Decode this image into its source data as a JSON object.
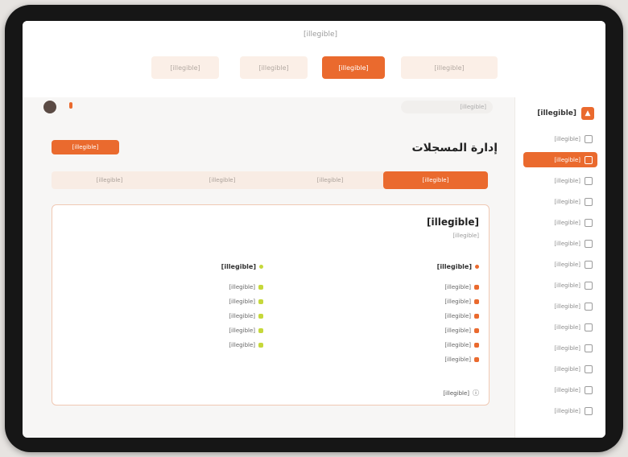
{
  "colors": {
    "accent": "#ea6a2e",
    "accent_soft": "#f8ece4",
    "green": "#c6d83b",
    "frame": "#161616"
  },
  "banner": {
    "text": "[illegible]",
    "tabs": [
      {
        "label": "[illegible]",
        "active": false
      },
      {
        "label": "[illegible]",
        "active": true
      },
      {
        "label": "[illegible]",
        "active": false
      },
      {
        "label": "[illegible]",
        "active": false
      }
    ]
  },
  "topbar": {
    "search_placeholder": "[illegible]"
  },
  "sidebar": {
    "logo_text": "[illegible]",
    "items": [
      {
        "label": "[illegible]",
        "icon": "home-icon",
        "active": false
      },
      {
        "label": "[illegible]",
        "icon": "list-icon",
        "active": true
      },
      {
        "label": "[illegible]",
        "icon": "gear-icon",
        "active": false
      },
      {
        "label": "[illegible]",
        "icon": "user-icon",
        "active": false
      },
      {
        "label": "[illegible]",
        "icon": "grid-icon",
        "active": false
      },
      {
        "label": "[illegible]",
        "icon": "chart-icon",
        "active": false
      },
      {
        "label": "[illegible]",
        "icon": "tag-icon",
        "active": false
      },
      {
        "label": "[illegible]",
        "icon": "file-icon",
        "active": false
      },
      {
        "label": "[illegible]",
        "icon": "mail-icon",
        "active": false
      },
      {
        "label": "[illegible]",
        "icon": "bell-icon",
        "active": false
      },
      {
        "label": "[illegible]",
        "icon": "users-icon",
        "active": false
      },
      {
        "label": "[illegible]",
        "icon": "calendar-icon",
        "active": false
      },
      {
        "label": "[illegible]",
        "icon": "box-icon",
        "active": false
      },
      {
        "label": "[illegible]",
        "icon": "settings-icon",
        "active": false
      }
    ]
  },
  "main": {
    "page_title": "إدارة المسجلات",
    "primary_button": "[illegible]",
    "tabs": [
      {
        "label": "[illegible]",
        "active": true
      },
      {
        "label": "[illegible]",
        "active": false
      },
      {
        "label": "[illegible]",
        "active": false
      },
      {
        "label": "[illegible]",
        "active": false
      }
    ],
    "card": {
      "title": "[illegible]",
      "subtitle": "[illegible]",
      "right_column": {
        "title": "[illegible]",
        "items": [
          "[illegible]",
          "[illegible]",
          "[illegible]",
          "[illegible]",
          "[illegible]",
          "[illegible]"
        ]
      },
      "left_column": {
        "title": "[illegible]",
        "items": [
          "[illegible]",
          "[illegible]",
          "[illegible]",
          "[illegible]",
          "[illegible]"
        ]
      },
      "footer_note": "[illegible]"
    }
  }
}
